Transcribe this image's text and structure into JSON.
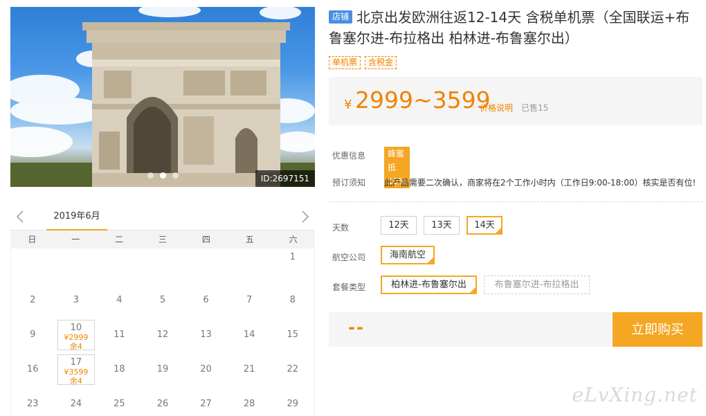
{
  "gallery": {
    "image_id": "ID:2697151",
    "dots": [
      false,
      true,
      false
    ]
  },
  "calendar": {
    "month_label": "2019年6月",
    "weekdays": [
      "日",
      "一",
      "二",
      "三",
      "四",
      "五",
      "六"
    ],
    "days": [
      {
        "day": ""
      },
      {
        "day": ""
      },
      {
        "day": ""
      },
      {
        "day": ""
      },
      {
        "day": ""
      },
      {
        "day": ""
      },
      {
        "day": "1"
      },
      {
        "day": "2"
      },
      {
        "day": "3"
      },
      {
        "day": "4"
      },
      {
        "day": "5"
      },
      {
        "day": "6"
      },
      {
        "day": "7"
      },
      {
        "day": "8"
      },
      {
        "day": "9"
      },
      {
        "day": "10",
        "price": "¥2999",
        "stock": "余4"
      },
      {
        "day": "11"
      },
      {
        "day": "12"
      },
      {
        "day": "13"
      },
      {
        "day": "14"
      },
      {
        "day": "15"
      },
      {
        "day": "16"
      },
      {
        "day": "17",
        "price": "¥3599",
        "stock": "余4"
      },
      {
        "day": "18"
      },
      {
        "day": "19"
      },
      {
        "day": "20"
      },
      {
        "day": "21"
      },
      {
        "day": "22"
      },
      {
        "day": "23"
      },
      {
        "day": "24"
      },
      {
        "day": "25"
      },
      {
        "day": "26"
      },
      {
        "day": "27"
      },
      {
        "day": "28"
      },
      {
        "day": "29"
      }
    ]
  },
  "product": {
    "shop_badge": "店铺",
    "title": "北京出发欧洲往返12-14天 含税单机票（全国联运+布鲁塞尔进-布拉格出 柏林进-布鲁塞尔出）",
    "tags": [
      "单机票",
      "含税金"
    ],
    "currency": "¥",
    "price_range": "2999~3599",
    "price_explain": "价格说明",
    "sold": "已售15"
  },
  "info": {
    "promo_label": "优惠信息",
    "promo_badge": "蜂蜜抵10%",
    "notice_label": "预订须知",
    "notice_text": "此产品需要二次确认，商家将在2个工作小时内（工作日9:00-18:00）核实是否有位!"
  },
  "options": {
    "days_label": "天数",
    "days": [
      "12天",
      "13天",
      "14天"
    ],
    "airline_label": "航空公司",
    "airline": "海南航空",
    "package_label": "套餐类型",
    "packages": [
      "柏林进-布鲁塞尔出",
      "布鲁塞尔进-布拉格出"
    ]
  },
  "buy": {
    "total": "--",
    "button": "立即购买"
  },
  "watermark": "eLvXing.net",
  "colors": {
    "accent": "#f5a623",
    "price": "#f08300",
    "shop_badge": "#4a90e2"
  }
}
